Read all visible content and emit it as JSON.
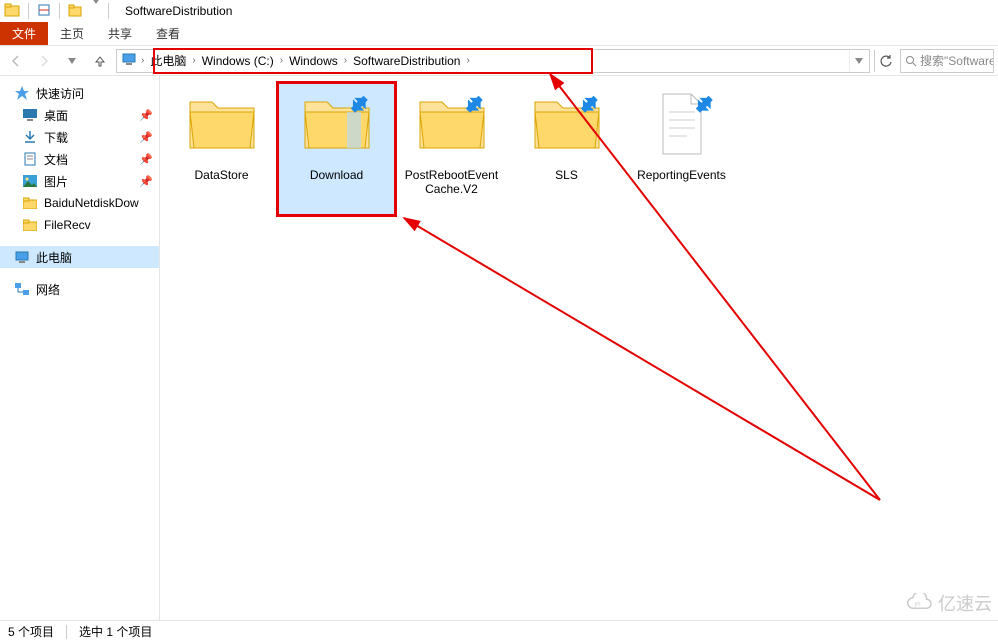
{
  "window": {
    "title": "SoftwareDistribution"
  },
  "ribbon": {
    "file": "文件",
    "tabs": [
      "主页",
      "共享",
      "查看"
    ]
  },
  "nav": {
    "back": "←",
    "forward": "→",
    "up": "↑"
  },
  "breadcrumb": {
    "items": [
      "此电脑",
      "Windows (C:)",
      "Windows",
      "SoftwareDistribution"
    ],
    "sep": "›"
  },
  "search": {
    "placeholder": "搜索\"SoftwareD"
  },
  "sidebar": {
    "quick": "快速访问",
    "items": [
      {
        "label": "桌面",
        "icon": "desktop",
        "pinned": true
      },
      {
        "label": "下载",
        "icon": "download",
        "pinned": true
      },
      {
        "label": "文档",
        "icon": "document",
        "pinned": true
      },
      {
        "label": "图片",
        "icon": "picture",
        "pinned": true
      },
      {
        "label": "BaiduNetdiskDow",
        "icon": "folder",
        "pinned": false
      },
      {
        "label": "FileRecv",
        "icon": "folder",
        "pinned": false
      }
    ],
    "pc": "此电脑",
    "network": "网络"
  },
  "content": {
    "items": [
      {
        "name": "DataStore",
        "type": "folder",
        "shared": false,
        "selected": false
      },
      {
        "name": "Download",
        "type": "folder",
        "shared": true,
        "selected": true
      },
      {
        "name": "PostRebootEventCache.V2",
        "type": "folder",
        "shared": true,
        "selected": false
      },
      {
        "name": "SLS",
        "type": "folder",
        "shared": true,
        "selected": false
      },
      {
        "name": "ReportingEvents",
        "type": "file",
        "shared": true,
        "selected": false
      }
    ]
  },
  "status": {
    "count": "5 个项目",
    "selected": "选中 1 个项目"
  },
  "watermark": "亿速云"
}
